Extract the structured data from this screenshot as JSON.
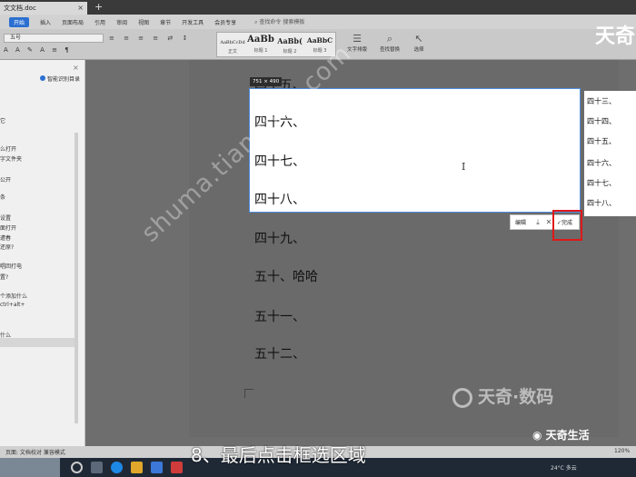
{
  "titlebar": {
    "doc_tab": "文文档.doc"
  },
  "menu": {
    "items": [
      "开始",
      "插入",
      "页面布局",
      "引用",
      "审阅",
      "视图",
      "章节",
      "开发工具",
      "会员专享"
    ],
    "search": "查找命令 搜索模板"
  },
  "ribbon": {
    "font_size": "五号",
    "styles": [
      {
        "sample": "AaBbCcDd",
        "name": "正文"
      },
      {
        "sample": "AaBb",
        "name": "标题 1"
      },
      {
        "sample": "AaBb(",
        "name": "标题 2"
      },
      {
        "sample": "AaBbC",
        "name": "标题 3"
      }
    ],
    "buttons": [
      {
        "icon": "text-layout-icon",
        "label": "文字排版"
      },
      {
        "icon": "find-replace-icon",
        "label": "查找替换"
      },
      {
        "icon": "select-icon",
        "label": "选择"
      }
    ]
  },
  "navpane": {
    "smart_toc": "智能识别目录",
    "items": [
      "它",
      "么打开",
      "字文件夹",
      "公开",
      "条",
      "设置",
      "面打开",
      "遭春",
      "还原?",
      "唱回打电",
      "置?",
      "个添加什么",
      "ctrl+alt+",
      "什么"
    ]
  },
  "document": {
    "lines_above": [
      "四十五、"
    ],
    "selected_lines": [
      "四十六、",
      "四十七、",
      "四十八、"
    ],
    "lines_below": [
      "四十九、",
      "五十、哈哈",
      "五十一、",
      "五十二、"
    ]
  },
  "capture": {
    "size_label": "751 × 490",
    "preview_items": [
      "四十三、",
      "四十四、",
      "四十五、",
      "四十六、",
      "四十七、",
      "四十八、"
    ],
    "toolbar": {
      "edit_label": "编辑",
      "done_label": "完成"
    },
    "highlight_color": "#e01818"
  },
  "watermark": {
    "url_text": "shuma.tianqijun.com",
    "brand_top": "天奇",
    "brand_mid": "天奇·数码",
    "brand_bottom": "天奇生活"
  },
  "statusbar": {
    "left_text": "页面: 文档校对  兼容模式",
    "zoom": "120%"
  },
  "caption": "8、最后点击框选区域",
  "taskbar": {
    "weather": "24°C 多云"
  }
}
